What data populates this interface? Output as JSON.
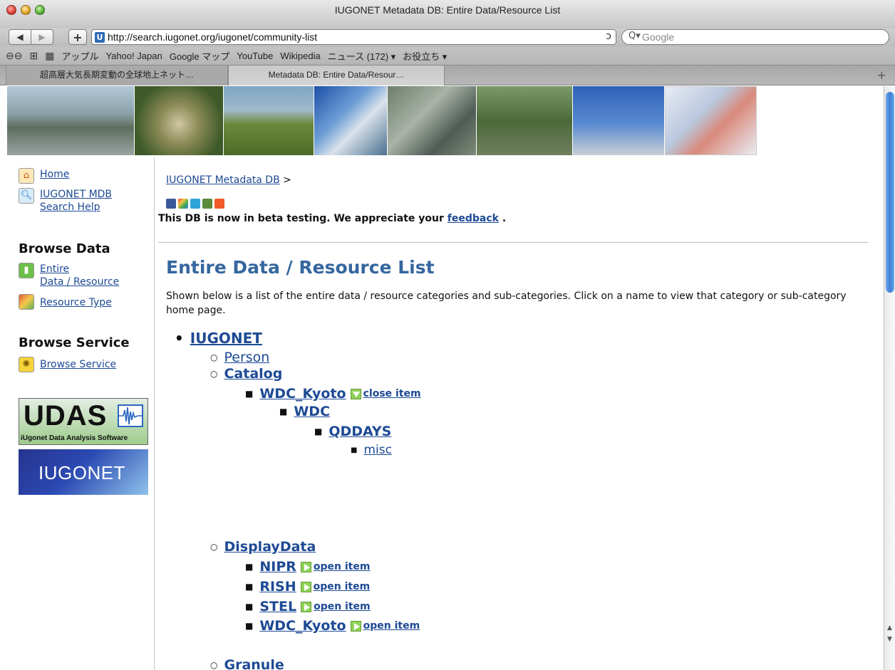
{
  "window": {
    "title": "IUGONET Metadata DB: Entire Data/Resource List"
  },
  "toolbar": {
    "back_glyph": "◀",
    "forward_glyph": "▶",
    "plus_glyph": "+",
    "url": "http://search.iugonet.org/iugonet/community-list",
    "reload_glyph": "ↄ",
    "search_placeholder": "Google",
    "search_glyph": "Q▾"
  },
  "bookmarks": {
    "items": [
      "アップル",
      "Yahoo! Japan",
      "Google マップ",
      "YouTube",
      "Wikipedia",
      "ニュース (172) ▾",
      "お役立ち ▾"
    ]
  },
  "tabs": [
    {
      "label": "超高層大気長期変動の全球地上ネット…"
    },
    {
      "label": "Metadata DB: Entire Data/Resour…"
    }
  ],
  "colors": {
    "link": "#1d4a94",
    "heading": "#35669f",
    "scroll_thumb": "#3e7fd4"
  },
  "sidebar": {
    "home": "Home",
    "search_help_line1": "IUGONET MDB",
    "search_help_line2": "Search Help",
    "browse_data_heading": "Browse Data",
    "entire_line1": "Entire",
    "entire_line2": "Data / Resource",
    "resource_type": "Resource Type",
    "browse_service_heading": "Browse Service",
    "browse_service": "Browse Service",
    "udas_logo_big": "UDAS",
    "udas_logo_sub": "iUgonet Data Analysis Software",
    "iugonet_logo": "IUGONET"
  },
  "content": {
    "breadcrumb_link": "IUGONET Metadata DB",
    "breadcrumb_sep": ">",
    "beta_prefix": "This DB is now in beta testing. We appreciate your",
    "beta_link": "feedback",
    "beta_suffix": ".",
    "heading": "Entire Data / Resource List",
    "intro": "Shown below is a list of the entire data / resource categories and sub-categories. Click on a name to view that category or sub-category home page."
  },
  "tree": {
    "root": "IUGONET",
    "person": "Person",
    "catalog": "Catalog",
    "wdc_kyoto": "WDC_Kyoto",
    "close_item": "close item",
    "wdc": "WDC",
    "qddays": "QDDAYS",
    "misc": "misc",
    "displaydata": "DisplayData",
    "nipr": "NIPR",
    "rish": "RISH",
    "stel": "STEL",
    "wdc_kyoto2": "WDC_Kyoto",
    "open_item": "open item",
    "granule": "Granule"
  }
}
